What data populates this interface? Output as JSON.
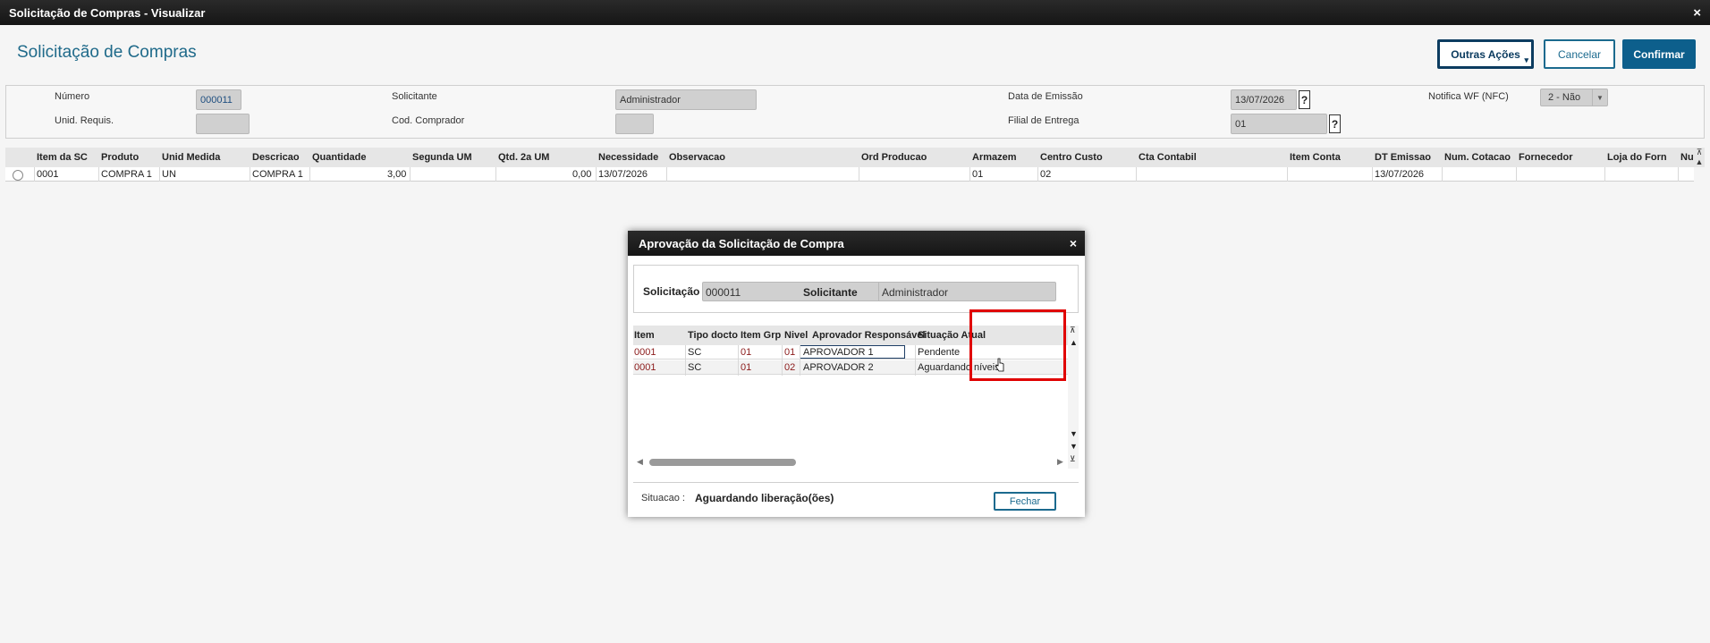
{
  "window": {
    "title": "Solicitação de Compras - Visualizar",
    "close": "×"
  },
  "header": {
    "title": "Solicitação de Compras"
  },
  "buttons": {
    "outras": "Outras Ações",
    "outras_caret": "▾",
    "cancelar": "Cancelar",
    "confirmar": "Confirmar"
  },
  "form": {
    "numero_label": "Número",
    "numero": "000011",
    "solicitante_label": "Solicitante",
    "solicitante": "Administrador",
    "data_label": "Data de Emissão",
    "data": "13/07/2026",
    "notifica_label": "Notifica WF (NFC)",
    "notifica": "2 - Não",
    "unid_label": "Unid. Requis.",
    "unid": "",
    "comprador_label": "Cod. Comprador",
    "comprador": "",
    "filial_label": "Filial de Entrega",
    "filial": "01",
    "help": "?",
    "select_arrow": "▼"
  },
  "grid": {
    "headers": [
      "Item da SC",
      "Produto",
      "Unid Medida",
      "Descricao",
      "Quantidade",
      "Segunda UM",
      "Qtd. 2a UM",
      "Necessidade",
      "Observacao",
      "Ord Producao",
      "Armazem",
      "Centro Custo",
      "Cta Contabil",
      "Item Conta",
      "DT Emissao",
      "Num. Cotacao",
      "Fornecedor",
      "Loja do Forn",
      "Nu"
    ],
    "row": [
      "0001",
      "COMPRA 1",
      "UN",
      "COMPRA 1",
      "3,00",
      "",
      "0,00",
      "13/07/2026",
      "",
      "",
      "01",
      "02",
      "",
      "",
      "13/07/2026",
      "",
      "",
      "",
      ""
    ],
    "scroll_top": "⊼",
    "scroll_up": "▲"
  },
  "dialog": {
    "title": "Aprovação da Solicitação de Compra",
    "close": "×",
    "solicitacao_label": "Solicitação",
    "solicitacao": "000011",
    "solicitante_label": "Solicitante",
    "solicitante": "Administrador",
    "headers": [
      "Item",
      "Tipo docto",
      "Item Grp",
      "Nivel",
      "Aprovador Responsável",
      "Situação Atual"
    ],
    "rows": [
      [
        "0001",
        "SC",
        "01",
        "01",
        "APROVADOR 1",
        "Pendente"
      ],
      [
        "0001",
        "SC",
        "01",
        "02",
        "APROVADOR 2",
        "Aguardando níveis"
      ]
    ],
    "situacao_label": "Situacao :",
    "situacao": "Aguardando liberação(ões)",
    "fechar": "Fechar",
    "scroll_top": "⊼",
    "scroll_up": "▲",
    "scroll_down": "▼",
    "scroll_bottom": "⊻",
    "scroll_left": "◀",
    "scroll_right": "▶"
  }
}
